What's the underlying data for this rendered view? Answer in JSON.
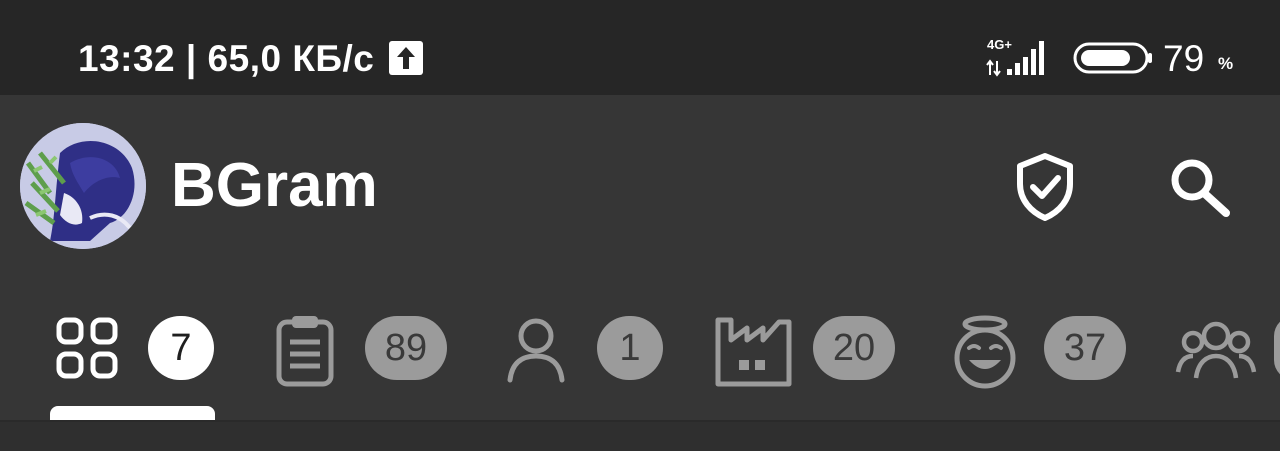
{
  "status_bar": {
    "time_speed": "13:32 | 65,0 КБ/с",
    "network_type": "4G+",
    "battery_level": "79",
    "battery_unit": "%",
    "battery_fill": 0.79
  },
  "app_bar": {
    "title": "BGram",
    "icons": [
      "avatar",
      "shield-check-icon",
      "search-icon"
    ]
  },
  "tabs": [
    {
      "icon": "grid-icon",
      "count": "7",
      "active": true
    },
    {
      "icon": "clipboard-icon",
      "count": "89",
      "active": false
    },
    {
      "icon": "user-icon",
      "count": "1",
      "active": false
    },
    {
      "icon": "factory-icon",
      "count": "20",
      "active": false
    },
    {
      "icon": "halo-face-icon",
      "count": "37",
      "active": false
    },
    {
      "icon": "group-icon",
      "count": "",
      "active": false
    }
  ],
  "colors": {
    "background": "#363636",
    "status_bar": "#262626",
    "badge_active": "#ffffff",
    "badge_inactive": "#9b9b9b"
  }
}
